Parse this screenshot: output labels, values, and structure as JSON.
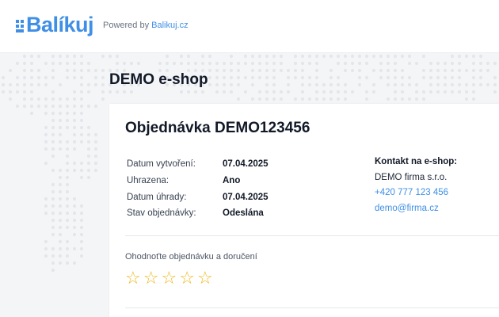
{
  "header": {
    "logo_text": "Balíkuj",
    "powered_prefix": "Powered by",
    "powered_link": "Balikuj.cz"
  },
  "shop": {
    "name": "DEMO e-shop"
  },
  "order": {
    "title": "Objednávka DEMO123456",
    "fields": [
      {
        "label": "Datum vytvoření:",
        "value": "07.04.2025"
      },
      {
        "label": "Uhrazena:",
        "value": "Ano"
      },
      {
        "label": "Datum úhrady:",
        "value": "07.04.2025"
      },
      {
        "label": "Stav objednávky:",
        "value": "Odeslána"
      }
    ]
  },
  "contact": {
    "title": "Kontakt na e-shop:",
    "company": "DEMO firma s.r.o.",
    "phone": "+420 777 123 456",
    "email": "demo@firma.cz"
  },
  "rating": {
    "label": "Ohodnoťte objednávku a doručení",
    "stars": [
      "☆",
      "☆",
      "☆",
      "☆",
      "☆"
    ],
    "value": 0,
    "max": 5
  },
  "colors": {
    "accent": "#3f8fe6",
    "star": "#f0b81c",
    "background": "#f4f5f7"
  }
}
